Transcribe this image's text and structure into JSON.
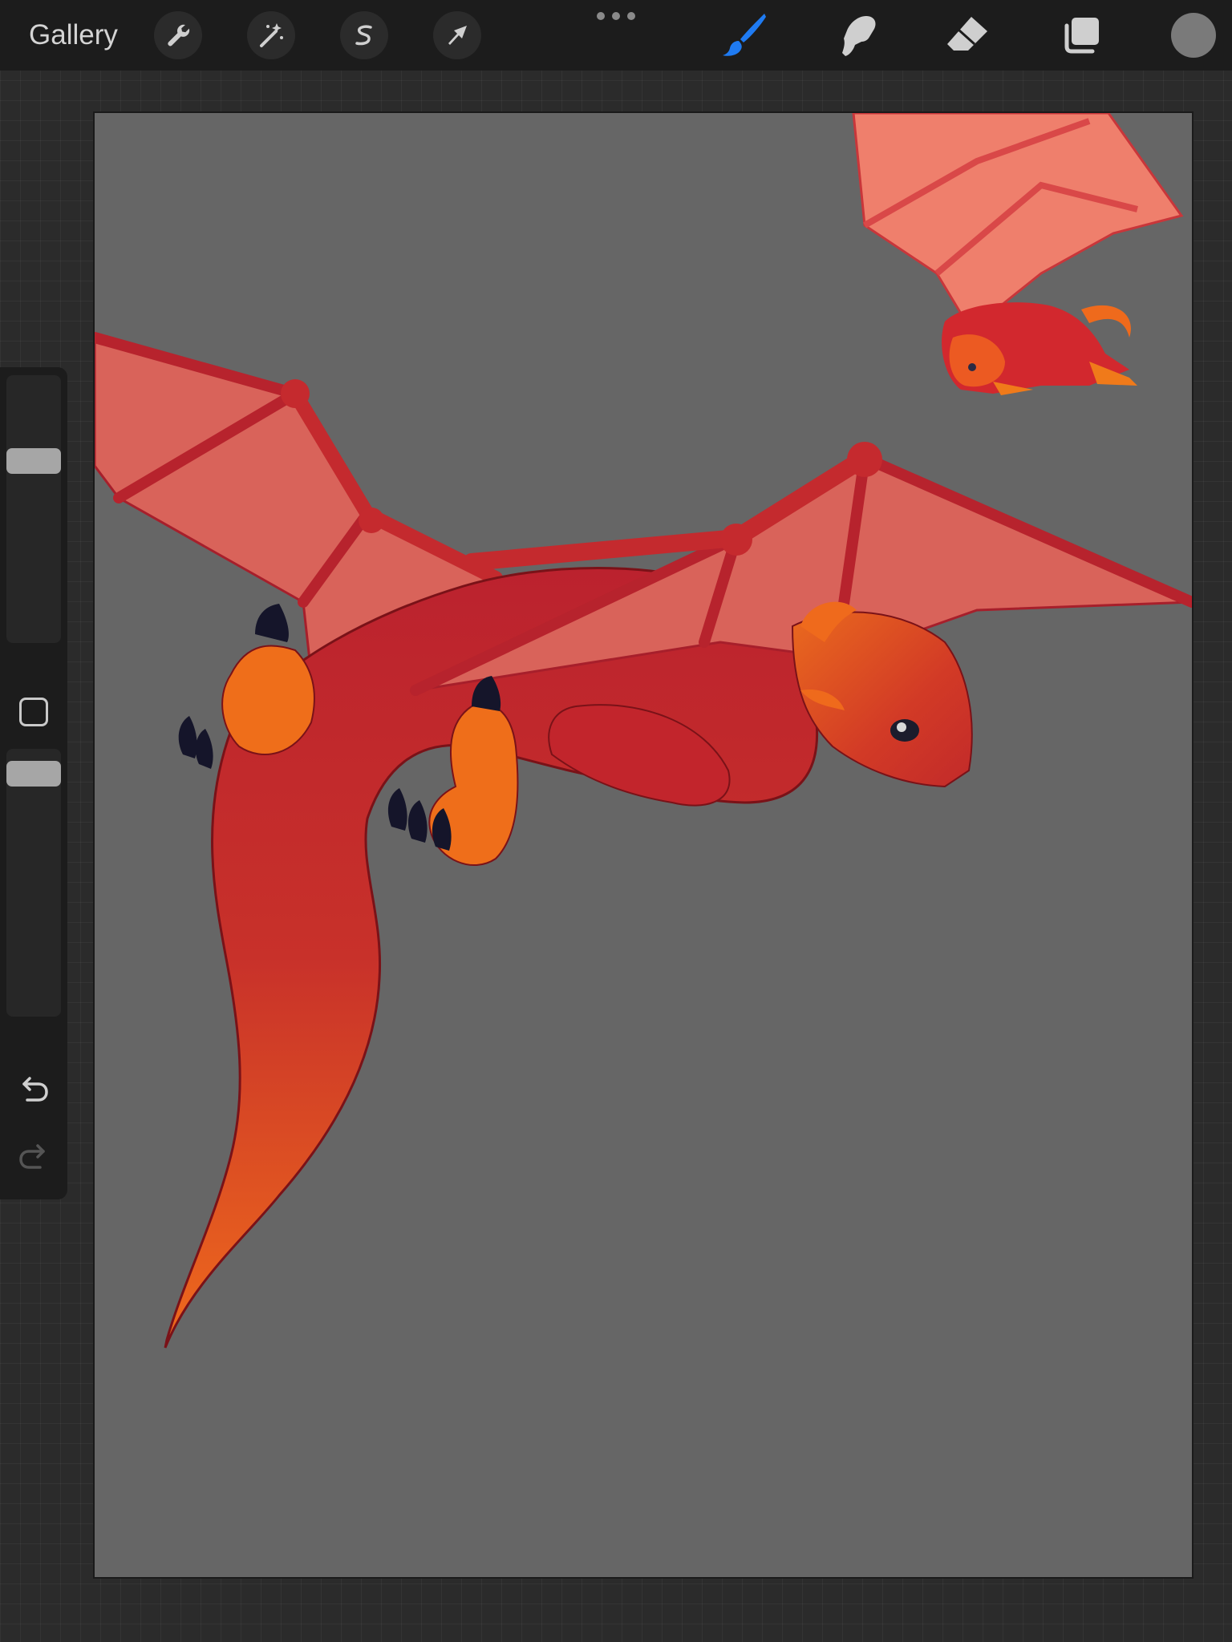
{
  "app": {
    "gallery_label": "Gallery"
  },
  "toolbar": {
    "left_tools": [
      {
        "name": "actions",
        "icon": "wrench-icon"
      },
      {
        "name": "adjustments",
        "icon": "magic-wand-icon"
      },
      {
        "name": "selection",
        "icon": "selection-s-icon"
      },
      {
        "name": "transform",
        "icon": "arrow-cursor-icon"
      }
    ],
    "right_tools": [
      {
        "name": "paint",
        "icon": "brush-icon",
        "active": true
      },
      {
        "name": "smudge",
        "icon": "smudge-finger-icon",
        "active": false
      },
      {
        "name": "erase",
        "icon": "eraser-icon",
        "active": false
      },
      {
        "name": "layers",
        "icon": "layers-icon",
        "active": false
      }
    ],
    "active_tool_color": "#1f7bf2",
    "inactive_tool_color": "#cfcfcf"
  },
  "current_color": "#7a7a7a",
  "sidebar": {
    "brush_size_level": 0.7,
    "brush_opacity_level": 0.95,
    "undo_icon": "undo-arrow-icon",
    "redo_icon": "redo-arrow-icon",
    "redo_enabled": false
  },
  "canvas": {
    "background_color": "#666666",
    "artwork": "red-dragon-illustration"
  }
}
